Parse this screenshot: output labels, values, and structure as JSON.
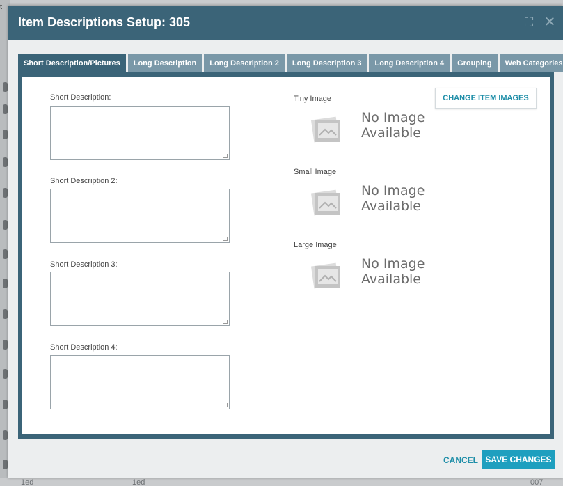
{
  "background": {
    "corner_char": "t",
    "bottom_left": "1ed",
    "bottom_mid": "1ed",
    "bottom_right": "007"
  },
  "modal": {
    "title": "Item Descriptions Setup: 305",
    "expand_icon": "⛶",
    "close_icon": "✕"
  },
  "tabs": [
    {
      "label": "Short Description/Pictures",
      "active": true
    },
    {
      "label": "Long Description"
    },
    {
      "label": "Long Description 2"
    },
    {
      "label": "Long Description 3"
    },
    {
      "label": "Long Description 4"
    },
    {
      "label": "Grouping"
    },
    {
      "label": "Web Categories"
    }
  ],
  "fields": [
    {
      "label": "Short Description:",
      "value": ""
    },
    {
      "label": "Short Description 2:",
      "value": ""
    },
    {
      "label": "Short Description 3:",
      "value": ""
    },
    {
      "label": "Short Description 4:",
      "value": ""
    }
  ],
  "images": [
    {
      "label": "Tiny Image",
      "line1": "No Image",
      "line2": "Available"
    },
    {
      "label": "Small Image",
      "line1": "No Image",
      "line2": "Available"
    },
    {
      "label": "Large Image",
      "line1": "No Image",
      "line2": "Available"
    }
  ],
  "change_images_label": "CHANGE ITEM IMAGES",
  "footer": {
    "cancel_label": "CANCEL",
    "save_label": "SAVE CHANGES"
  },
  "colors": {
    "header": "#3b6478",
    "tab_inactive": "#7a98a8",
    "accent": "#1e9fbf"
  }
}
